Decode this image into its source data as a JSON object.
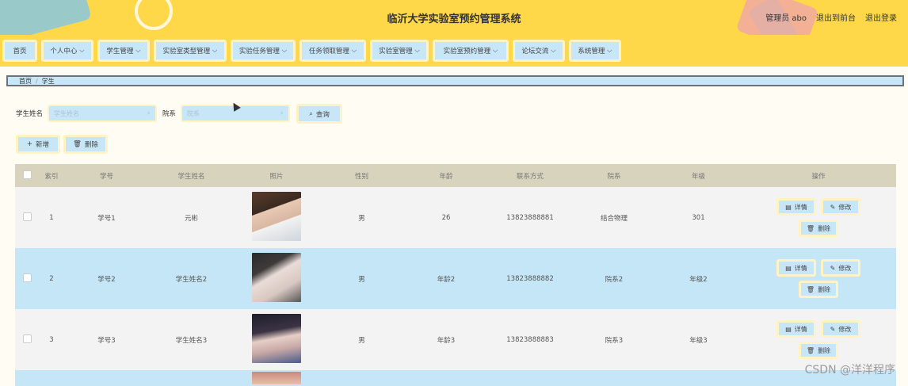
{
  "header": {
    "title": "临沂大学实验室预约管理系统",
    "user_label": "管理员 abo",
    "front_link": "退出到前台",
    "logout_link": "退出登录"
  },
  "nav": {
    "items": [
      {
        "label": "首页",
        "has_dropdown": false
      },
      {
        "label": "个人中心",
        "has_dropdown": true
      },
      {
        "label": "学生管理",
        "has_dropdown": true
      },
      {
        "label": "实验室类型管理",
        "has_dropdown": true
      },
      {
        "label": "实验任务管理",
        "has_dropdown": true
      },
      {
        "label": "任务领取管理",
        "has_dropdown": true
      },
      {
        "label": "实验室管理",
        "has_dropdown": true
      },
      {
        "label": "实验室预约管理",
        "has_dropdown": true
      },
      {
        "label": "论坛交流",
        "has_dropdown": true
      },
      {
        "label": "系统管理",
        "has_dropdown": true
      }
    ]
  },
  "breadcrumb": {
    "home": "首页",
    "sep": "/",
    "current": "学生"
  },
  "search": {
    "name_label": "学生姓名",
    "name_placeholder": "学生姓名",
    "dept_label": "院系",
    "dept_placeholder": "院系",
    "query_button": "查询"
  },
  "actions": {
    "add": "新增",
    "delete": "删除"
  },
  "table": {
    "columns": [
      "索引",
      "学号",
      "学生姓名",
      "照片",
      "性别",
      "年龄",
      "联系方式",
      "院系",
      "年级",
      "操作"
    ],
    "rows": [
      {
        "index": "1",
        "student_no": "学号1",
        "name": "元彬",
        "gender": "男",
        "age": "26",
        "phone": "13823888881",
        "dept": "结合物理",
        "grade": "301"
      },
      {
        "index": "2",
        "student_no": "学号2",
        "name": "学生姓名2",
        "gender": "男",
        "age": "年龄2",
        "phone": "13823888882",
        "dept": "院系2",
        "grade": "年级2"
      },
      {
        "index": "3",
        "student_no": "学号3",
        "name": "学生姓名3",
        "gender": "男",
        "age": "年龄3",
        "phone": "13823888883",
        "dept": "院系3",
        "grade": "年级3"
      }
    ],
    "row_actions": {
      "detail": "详情",
      "edit": "修改",
      "delete": "删除"
    }
  },
  "watermark": "CSDN @洋洋程序",
  "colors": {
    "header_bg": "#ffd84a",
    "accent_blue": "#c7e6f7",
    "table_header": "#d8d3bd",
    "row_alt": "#c4e6f7"
  }
}
